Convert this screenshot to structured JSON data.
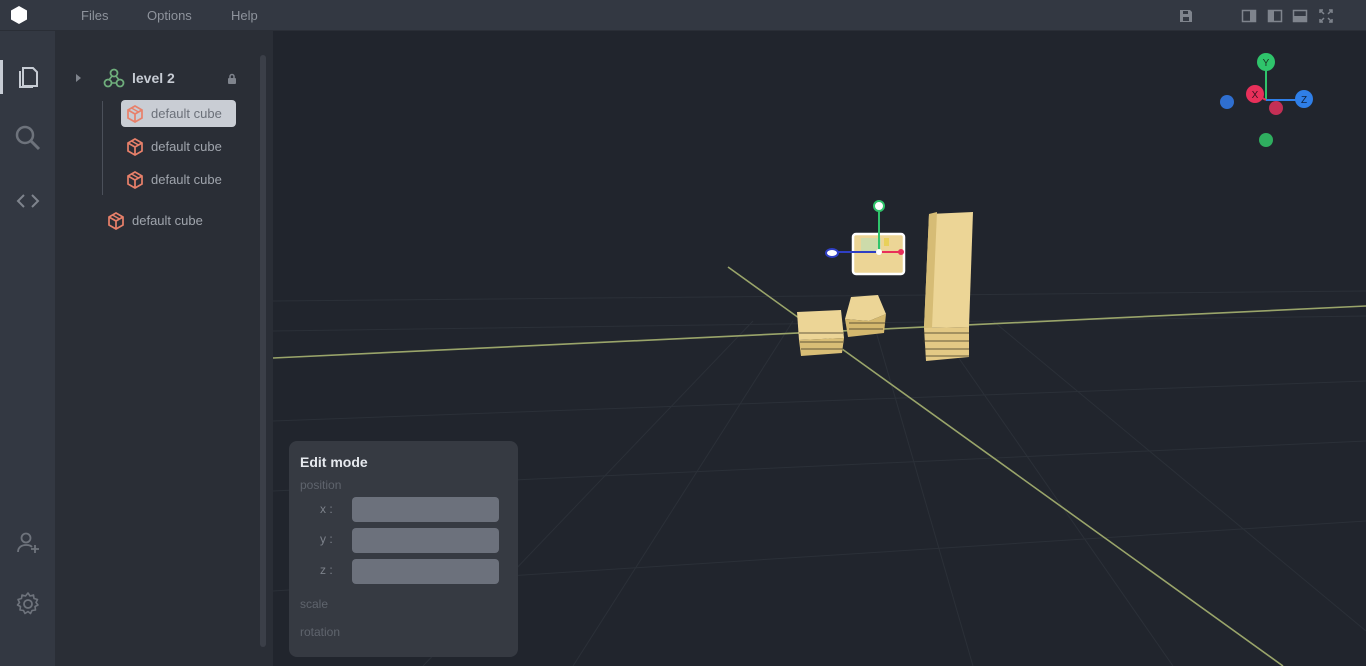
{
  "menu": {
    "items": [
      "Files",
      "Options",
      "Help"
    ]
  },
  "toolbar_icons": [
    "save-icon",
    "panel-left-icon",
    "panel-right-icon",
    "panel-bottom-icon",
    "fullscreen-icon"
  ],
  "activity_bar": {
    "top": [
      "files-icon",
      "search-icon",
      "code-icon"
    ],
    "bottom": [
      "add-user-icon",
      "settings-icon"
    ]
  },
  "scene_tree": {
    "group": {
      "label": "level 2",
      "locked": true
    },
    "children": [
      {
        "label": "default cube",
        "selected": true
      },
      {
        "label": "default cube",
        "selected": false
      },
      {
        "label": "default cube",
        "selected": false
      }
    ],
    "root_items": [
      {
        "label": "default cube"
      }
    ]
  },
  "gizmo": {
    "axes": [
      "Y",
      "X",
      "Z"
    ],
    "colors": {
      "x": "#e8305a",
      "y": "#2fc46b",
      "z": "#2f7fe8"
    }
  },
  "edit_panel": {
    "title": "Edit mode",
    "position_label": "position",
    "x_label": "x :",
    "y_label": "y :",
    "z_label": "z :",
    "x_value": "",
    "y_value": "",
    "z_value": "",
    "scale_label": "scale",
    "rotation_label": "rotation"
  },
  "colors": {
    "accent_cube_icon": "#e8806a",
    "group_icon": "#6fae7c",
    "cube_fill": "#ecd596",
    "grid_axis": "#9aa56a"
  }
}
